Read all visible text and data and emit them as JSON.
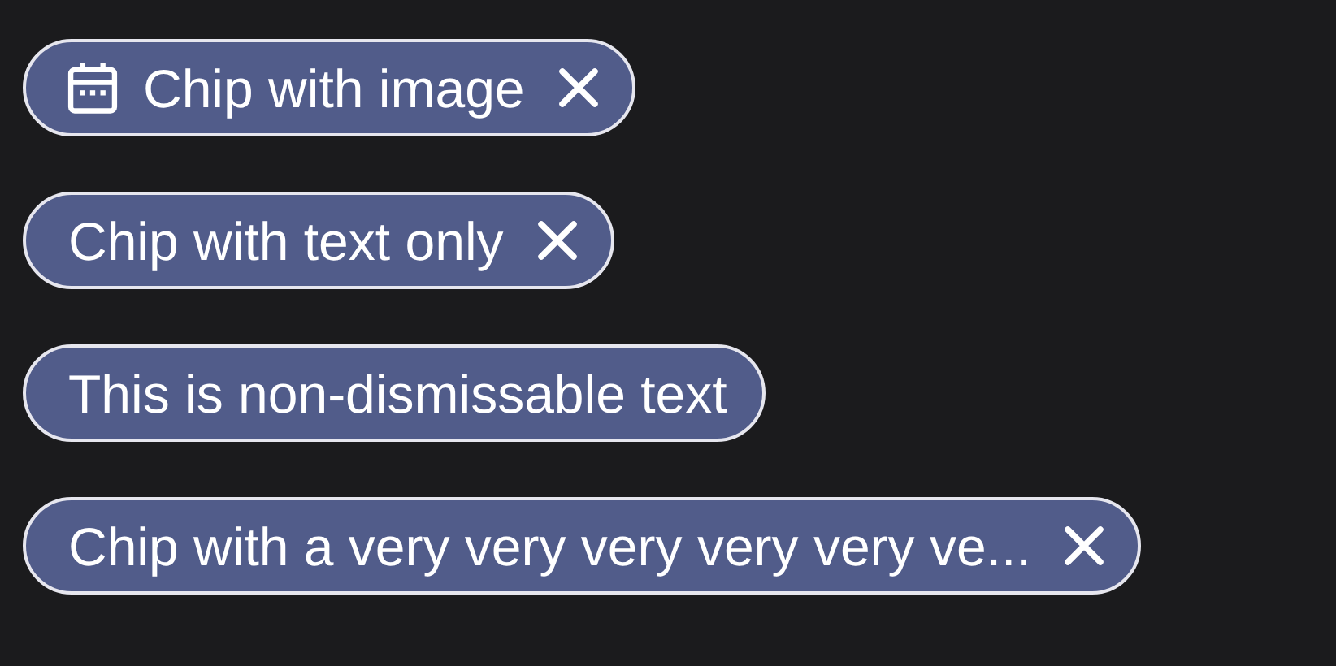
{
  "chips": [
    {
      "kind": "image",
      "label": "Chip with image",
      "dismissible": true
    },
    {
      "kind": "text",
      "label": "Chip with text only",
      "dismissible": true
    },
    {
      "kind": "text",
      "label": "This is non-dismissable text",
      "dismissible": false
    },
    {
      "kind": "text",
      "label": "Chip with a very very very very very ve...",
      "dismissible": true
    }
  ]
}
